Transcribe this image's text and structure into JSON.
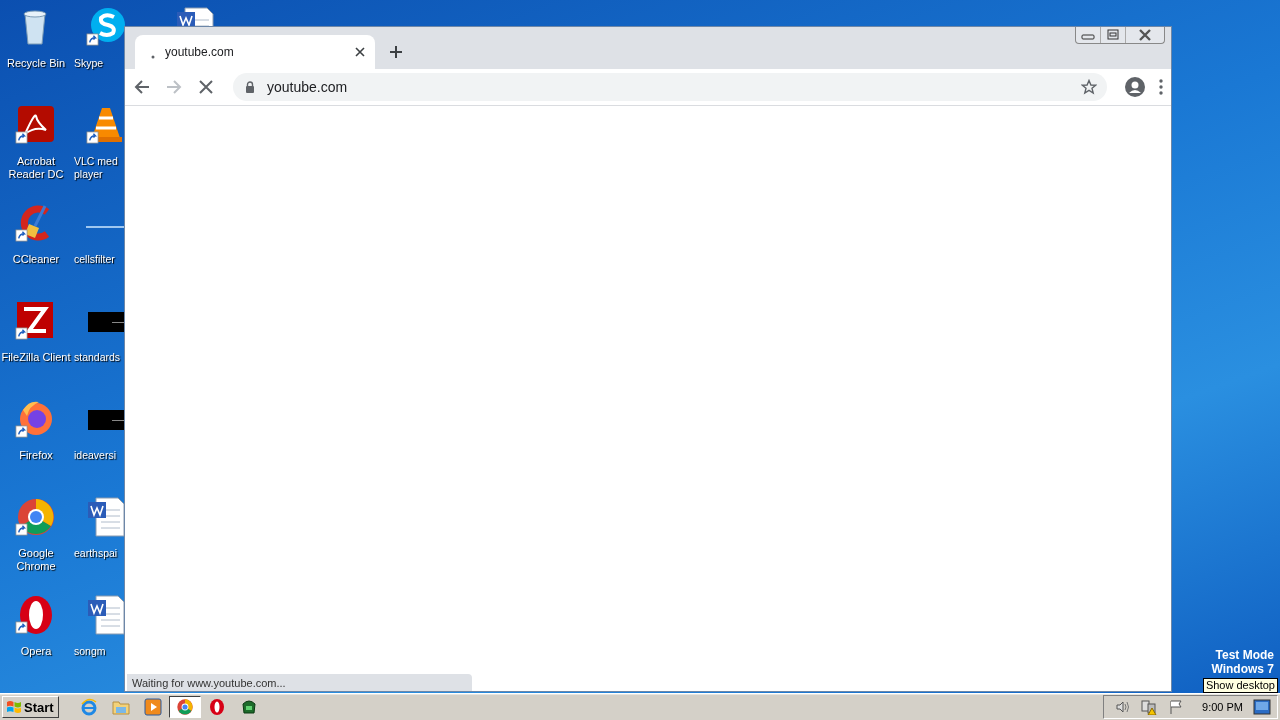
{
  "desktop_icons": [
    {
      "label": "Recycle Bin",
      "kind": "recycle-bin"
    },
    {
      "label": "Acrobat Reader DC",
      "kind": "acrobat",
      "shortcut": true
    },
    {
      "label": "CCleaner",
      "kind": "ccleaner",
      "shortcut": true
    },
    {
      "label": "FileZilla Client",
      "kind": "filezilla",
      "shortcut": true
    },
    {
      "label": "Firefox",
      "kind": "firefox",
      "shortcut": true
    },
    {
      "label": "Google Chrome",
      "kind": "chrome",
      "shortcut": true
    },
    {
      "label": "Opera",
      "kind": "opera",
      "shortcut": true
    },
    {
      "label": "Skype",
      "kind": "skype",
      "shortcut": true
    },
    {
      "label": "VLC med player",
      "kind": "vlc",
      "shortcut": true
    },
    {
      "label": "cellsfilter",
      "kind": "line-file"
    },
    {
      "label": "standards",
      "kind": "black-file"
    },
    {
      "label": "ideaversi",
      "kind": "black-file"
    },
    {
      "label": "earthspai",
      "kind": "word-doc"
    },
    {
      "label": "songm",
      "kind": "word-doc"
    },
    {
      "kind": "word-doc"
    }
  ],
  "browser": {
    "tabs": [
      {
        "title": "youtube.com",
        "selected": true
      }
    ],
    "forward_enabled": false,
    "loading": true,
    "address": "youtube.com",
    "status": "Waiting for www.youtube.com..."
  },
  "desktop_notice": [
    "Test Mode",
    "Windows 7"
  ],
  "tooltip": "Show desktop",
  "taskbar": {
    "start": "Start",
    "apps": [
      {
        "kind": "ie",
        "selected": false
      },
      {
        "kind": "explorer",
        "selected": false
      },
      {
        "kind": "media",
        "selected": false
      },
      {
        "kind": "chrome",
        "selected": true
      },
      {
        "kind": "opera",
        "selected": false
      },
      {
        "kind": "green-app",
        "selected": false
      }
    ],
    "clock": "9:00 PM"
  }
}
